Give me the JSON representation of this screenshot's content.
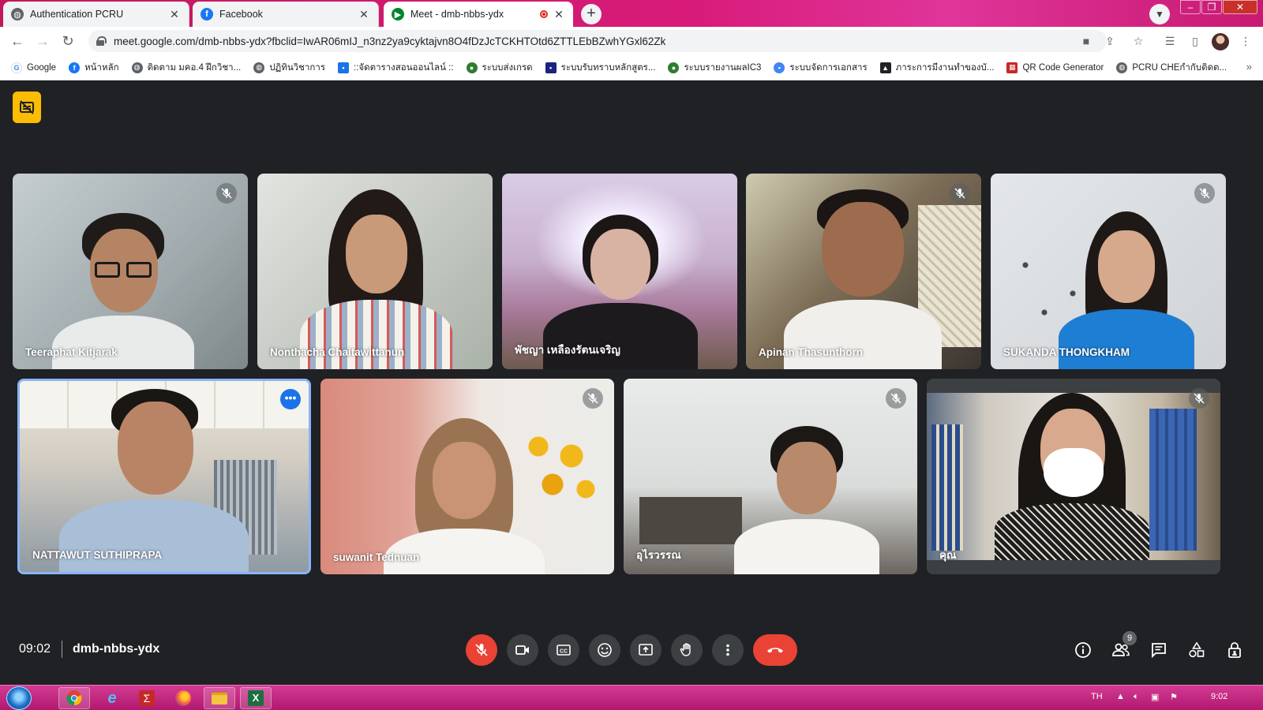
{
  "browser": {
    "tabs": [
      {
        "title": "Authentication PCRU",
        "active": false
      },
      {
        "title": "Facebook",
        "active": false
      },
      {
        "title": "Meet - dmb-nbbs-ydx",
        "active": true
      }
    ],
    "url": "meet.google.com/dmb-nbbs-ydx?fbclid=IwAR06mIJ_n3nz2ya9cyktajvn8O4fDzJcTCKHTOtd6ZTTLEbBZwhYGxl62Zk",
    "bookmarks": [
      "Google",
      "หน้าหลัก",
      "ติดตาม มคอ.4 ฝึกวิชา...",
      "ปฏิทินวิชาการ",
      "::จัดตารางสอนออนไลน์ ::",
      "ระบบส่งเกรด",
      "ระบบรับทราบหลักสูตร...",
      "ระบบรายงานผลIC3",
      "ระบบจัดการเอกสาร",
      "ภาระการมีงานทำของบั...",
      "QR Code Generator",
      "PCRU CHEกำกับติดต..."
    ]
  },
  "meeting": {
    "time": "09:02",
    "code": "dmb-nbbs-ydx",
    "participant_count": "9",
    "participants": [
      "Teeraphat Kitjarak",
      "Nonthacha Chaitawittanun",
      "พัชญา เหลืองรัตนเจริญ",
      "Apinan Thasunthorn",
      "SUKANDA THONGKHAM",
      "NATTAWUT SUTHIPRAPA",
      "suwanit Tednuan",
      "อุไรวรรณ",
      "คุณ"
    ]
  },
  "taskbar": {
    "language": "TH",
    "clock": "9:02"
  },
  "colors": {
    "meet_bg": "#202124",
    "control_bg": "#3c4043",
    "danger": "#ea4335",
    "speaking_border": "#8ab4f8",
    "badge_yellow": "#fbbc04",
    "taskbar": "#c2187b"
  }
}
